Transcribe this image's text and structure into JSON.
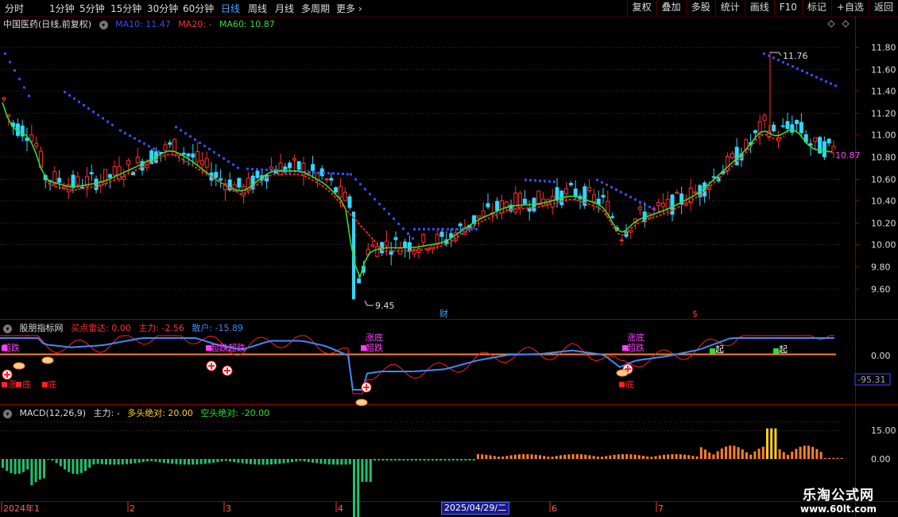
{
  "toolbar": {
    "periods": [
      "分时",
      "1分钟",
      "5分钟",
      "15分钟",
      "30分钟",
      "60分钟",
      "日线",
      "周线",
      "月线",
      "多周期",
      "更多"
    ],
    "active_period": "日线",
    "tools": [
      "复权",
      "叠加",
      "多股",
      "统计",
      "画线",
      "F10",
      "标记",
      "+自选",
      "返回"
    ]
  },
  "main_panel": {
    "title": "中国医药(日线,前复权)",
    "ma_legend": [
      {
        "label": "MA10: 11.47",
        "color": "#3a4cff"
      },
      {
        "label": "MA20: -",
        "color": "#ff3030"
      },
      {
        "label": "MA60: 10.87",
        "color": "#30e030"
      }
    ],
    "y_ticks": [
      "11.80",
      "11.60",
      "11.40",
      "11.20",
      "11.00",
      "10.80",
      "10.60",
      "10.40",
      "10.20",
      "10.00",
      "9.80",
      "9.60"
    ],
    "high_label": "11.76",
    "low_label": "9.45",
    "last_price_label": "10.87",
    "markers": [
      "财",
      "$"
    ]
  },
  "indicator_panel": {
    "title": "股朋指标网",
    "legend": [
      {
        "label": "买点雷达: 0.00",
        "color": "#ff3030"
      },
      {
        "label": "主力: -2.56",
        "color": "#ff3030"
      },
      {
        "label": "散户: -15.89",
        "color": "#3a8cff"
      }
    ],
    "y_tick": "0.00",
    "current_value": "-95.31",
    "signals": {
      "rise": "涨",
      "bottom": "底",
      "super_drop": "超跌",
      "start": "起"
    }
  },
  "macd_panel": {
    "title": "MACD(12,26,9)",
    "legend": [
      {
        "label": "主力: -",
        "color": "#ddd"
      },
      {
        "label": "多头绝对: 20.00",
        "color": "#ffd020"
      },
      {
        "label": "空头绝对: -20.00",
        "color": "#30e030"
      }
    ],
    "y_ticks": [
      "15.00",
      "0.00"
    ]
  },
  "time_axis": {
    "labels": [
      "2024年1",
      "2",
      "3",
      "4",
      "6",
      "7"
    ],
    "cursor_date": "2025/04/29/二"
  },
  "watermark": {
    "line1": "乐淘公式网",
    "line2": "www.60lt.com"
  }
}
